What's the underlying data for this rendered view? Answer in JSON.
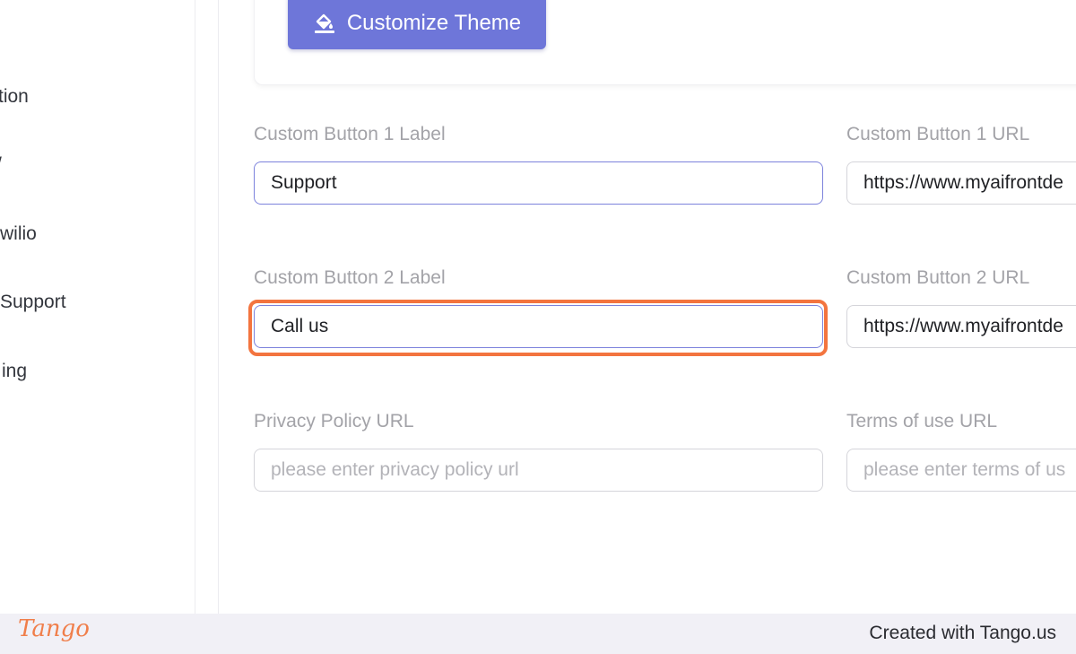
{
  "sidebar": {
    "items": [
      {
        "label": "tion"
      },
      {
        "label": "/"
      },
      {
        "label": "wilio"
      },
      {
        "label": "Support"
      },
      {
        "label": "ing"
      }
    ]
  },
  "theme": {
    "button_label": "Customize Theme",
    "button_icon": "paint-bucket-icon",
    "accent_color": "#6e76d9"
  },
  "form": {
    "button1_label": {
      "label": "Custom Button 1 Label",
      "value": "Support"
    },
    "button1_url": {
      "label": "Custom Button 1 URL",
      "value": "https://www.myaifrontde"
    },
    "button2_label": {
      "label": "Custom Button 2 Label",
      "value": "Call us"
    },
    "button2_url": {
      "label": "Custom Button 2 URL",
      "value": "https://www.myaifrontde"
    },
    "privacy_url": {
      "label": "Privacy Policy URL",
      "placeholder": "please enter privacy policy url"
    },
    "terms_url": {
      "label": "Terms of use URL",
      "placeholder": "please enter terms of us"
    }
  },
  "highlight_color": "#f3743f",
  "footer": {
    "logo": "Tango",
    "credit": "Created with Tango.us"
  }
}
